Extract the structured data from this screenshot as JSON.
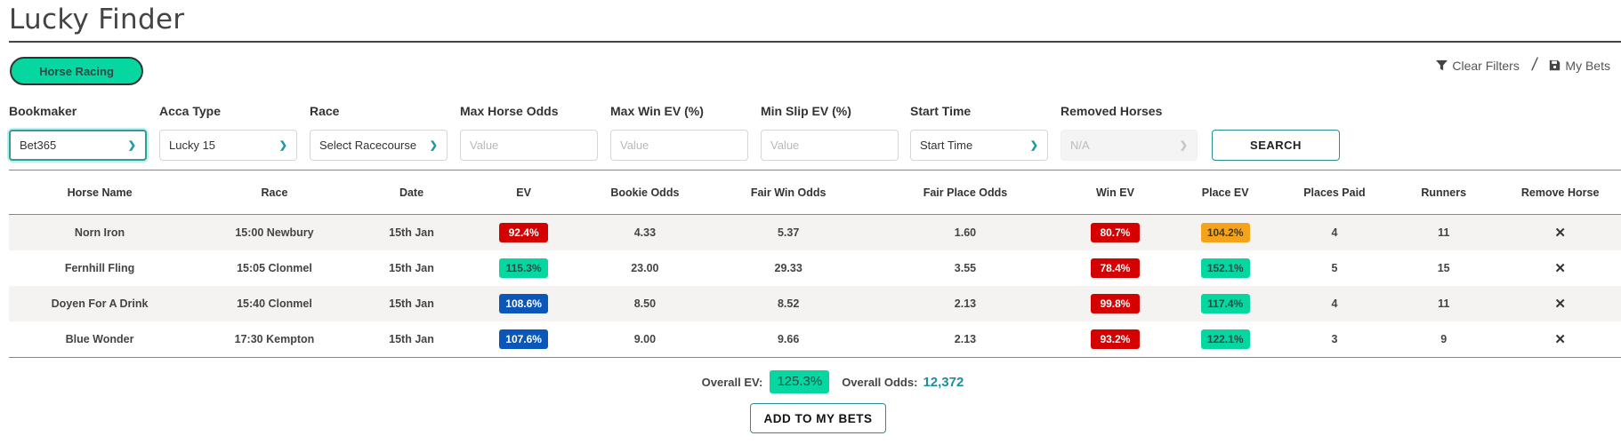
{
  "header": {
    "title": "Lucky Finder",
    "sport_pill": "Horse Racing",
    "clear_filters": "Clear Filters",
    "separator": "/",
    "my_bets": "My Bets"
  },
  "filters": {
    "bookmaker": {
      "label": "Bookmaker",
      "value": "Bet365"
    },
    "acca_type": {
      "label": "Acca Type",
      "value": "Lucky 15"
    },
    "race": {
      "label": "Race",
      "value": "Select Racecourse"
    },
    "max_horse_odds": {
      "label": "Max Horse Odds",
      "placeholder": "Value"
    },
    "max_win_ev": {
      "label": "Max Win EV (%)",
      "placeholder": "Value"
    },
    "min_slip_ev": {
      "label": "Min Slip EV (%)",
      "placeholder": "Value"
    },
    "start_time": {
      "label": "Start Time",
      "value": "Start Time"
    },
    "removed_horses": {
      "label": "Removed Horses",
      "value": "N/A"
    },
    "search_label": "SEARCH"
  },
  "table": {
    "columns": [
      "Horse Name",
      "Race",
      "Date",
      "EV",
      "Bookie Odds",
      "Fair Win Odds",
      "Fair Place Odds",
      "Win EV",
      "Place EV",
      "Places Paid",
      "Runners",
      "Remove Horse"
    ],
    "rows": [
      {
        "horse": "Norn Iron",
        "race": "15:00 Newbury",
        "date": "15th Jan",
        "ev": "92.4%",
        "ev_color": "red",
        "bookie_odds": "4.33",
        "fair_win_odds": "5.37",
        "fair_place_odds": "1.60",
        "win_ev": "80.7%",
        "win_ev_color": "red",
        "place_ev": "104.2%",
        "place_ev_color": "orange",
        "places_paid": "4",
        "runners": "11",
        "remove": "✕"
      },
      {
        "horse": "Fernhill Fling",
        "race": "15:05 Clonmel",
        "date": "15th Jan",
        "ev": "115.3%",
        "ev_color": "green",
        "bookie_odds": "23.00",
        "fair_win_odds": "29.33",
        "fair_place_odds": "3.55",
        "win_ev": "78.4%",
        "win_ev_color": "red",
        "place_ev": "152.1%",
        "place_ev_color": "green",
        "places_paid": "5",
        "runners": "15",
        "remove": "✕"
      },
      {
        "horse": "Doyen For A Drink",
        "race": "15:40 Clonmel",
        "date": "15th Jan",
        "ev": "108.6%",
        "ev_color": "blue",
        "bookie_odds": "8.50",
        "fair_win_odds": "8.52",
        "fair_place_odds": "2.13",
        "win_ev": "99.8%",
        "win_ev_color": "red",
        "place_ev": "117.4%",
        "place_ev_color": "green",
        "places_paid": "4",
        "runners": "11",
        "remove": "✕"
      },
      {
        "horse": "Blue Wonder",
        "race": "17:30 Kempton",
        "date": "15th Jan",
        "ev": "107.6%",
        "ev_color": "blue",
        "bookie_odds": "9.00",
        "fair_win_odds": "9.66",
        "fair_place_odds": "2.13",
        "win_ev": "93.2%",
        "win_ev_color": "red",
        "place_ev": "122.1%",
        "place_ev_color": "green",
        "places_paid": "3",
        "runners": "9",
        "remove": "✕"
      }
    ]
  },
  "summary": {
    "overall_ev_label": "Overall EV:",
    "overall_ev": "125.3%",
    "overall_odds_label": "Overall Odds:",
    "overall_odds": "12,372",
    "add_button": "ADD TO MY BETS"
  },
  "colors": {
    "accent_green": "#06d6a0",
    "teal": "#1c8f9a",
    "red": "#d50000",
    "blue": "#0a56b9",
    "orange": "#f5a31a"
  }
}
